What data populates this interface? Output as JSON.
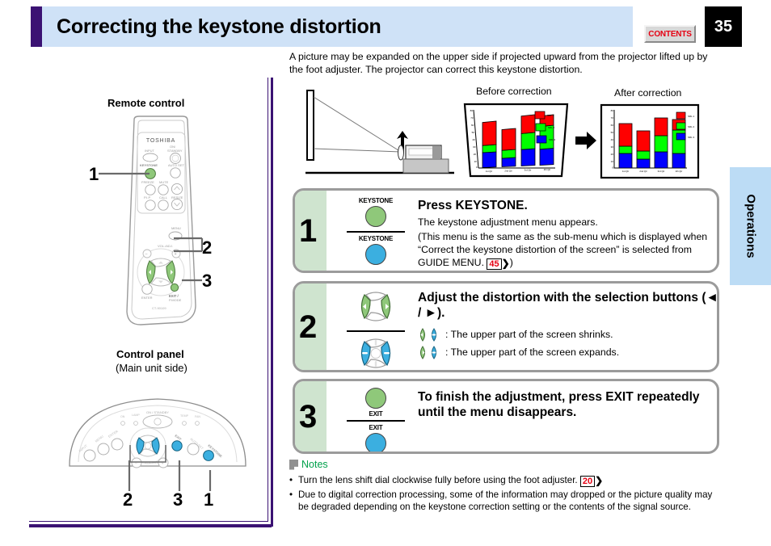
{
  "header": {
    "title": "Correcting the keystone distortion",
    "contents_label": "CONTENTS",
    "page_number": "35"
  },
  "side_tab": {
    "label": "Operations"
  },
  "intro": "A picture may be expanded on the upper side if projected upward from the projector lifted up by the foot adjuster. The projector can correct this keystone distortion.",
  "figures": {
    "before_caption": "Before correction",
    "after_caption": "After correction"
  },
  "left_column": {
    "remote_label": "Remote control",
    "control_panel_label": "Control panel",
    "control_panel_sub": "(Main unit side)",
    "remote_brand": "TOSHIBA",
    "remote_model": "CT-90109",
    "remote_callouts": [
      "1",
      "2",
      "3"
    ],
    "panel_callouts": [
      "2",
      "3",
      "1"
    ],
    "remote_button_labels": [
      "INPUT",
      "ON/ STANDBY",
      "KEYSTONE",
      "AUTO SET",
      "FREEZE",
      "MUTE",
      "P.IP",
      "CALL",
      "RESIZE",
      "MENU",
      "VOL./ADJ.",
      "ENTER",
      "EXIT/ P.MODE"
    ],
    "panel_labels": [
      "ON / STANDBY",
      "ON",
      "LAMP",
      "TEMP",
      "FAN",
      "INPUT",
      "MENU",
      "ENTER",
      "EXIT",
      "AUTO SET",
      "KEYSTONE",
      "VOL./ADJ."
    ]
  },
  "steps": [
    {
      "number": "1",
      "button_top_caption": "KEYSTONE",
      "button_bottom_caption": "KEYSTONE",
      "title": "Press KEYSTONE.",
      "lines": [
        "The keystone adjustment menu appears.",
        "(This menu is the same as the sub-menu which is displayed when “Correct the keystone distortion of the screen” is selected from GUIDE MENU."
      ],
      "page_ref": "45",
      "line_tail": ")"
    },
    {
      "number": "2",
      "title": "Adjust the distortion with the selection buttons (◄ / ►).",
      "bullets": [
        ": The upper part of the screen shrinks.",
        ": The upper part of the screen expands."
      ]
    },
    {
      "number": "3",
      "button_top_caption": "EXIT",
      "button_bottom_caption": "EXIT",
      "title": "To finish the adjustment, press EXIT repeatedly until the menu disappears."
    }
  ],
  "notes": {
    "heading": "Notes",
    "items": [
      {
        "text": "Turn the lens shift dial clockwise fully before using the foot adjuster.",
        "page_ref": "20"
      },
      {
        "text": "Due to digital correction processing, some of the information may dropped or the picture quality may be degraded depending on the keystone correction setting or the contents of the signal source.",
        "page_ref": ""
      }
    ],
    "bullet": "•"
  },
  "colors": {
    "accent_purple": "#3b1273",
    "header_blue": "#cfe2f7",
    "tab_blue": "#bcdcf5",
    "step_green": "#cfe4cf",
    "button_green": "#8fc87a",
    "button_blue": "#3bafe0",
    "red": "#e60012",
    "notes_green": "#00a14b"
  },
  "chart_data": [
    {
      "id": "before-correction",
      "type": "bar",
      "stacked": true,
      "title": "Before correction",
      "distorted": true,
      "categories": [
        "1st Qtr",
        "2nd Qtr",
        "3rd Qtr",
        "4th Qtr"
      ],
      "series": [
        {
          "name": "SRL 3",
          "color": "#0000ff",
          "values": [
            20,
            12,
            22,
            20
          ]
        },
        {
          "name": "SRL 2",
          "color": "#00ff00",
          "values": [
            10,
            11,
            22,
            32
          ]
        },
        {
          "name": "SRL 1",
          "color": "#ff0000",
          "values": [
            35,
            31,
            35,
            22
          ]
        }
      ],
      "yticks": [
        "0",
        "10",
        "20",
        "30",
        "40",
        "50",
        "60",
        "70",
        "80"
      ],
      "ylim": [
        0,
        80
      ],
      "legend": "right",
      "grid": false
    },
    {
      "id": "after-correction",
      "type": "bar",
      "stacked": true,
      "title": "After correction",
      "distorted": false,
      "categories": [
        "1st Qtr",
        "2nd Qtr",
        "3rd Qtr",
        "4th Qtr"
      ],
      "series": [
        {
          "name": "SRL 3",
          "color": "#0000ff",
          "values": [
            20,
            12,
            22,
            20
          ]
        },
        {
          "name": "SRL 2",
          "color": "#00ff00",
          "values": [
            10,
            11,
            22,
            32
          ]
        },
        {
          "name": "SRL 1",
          "color": "#ff0000",
          "values": [
            35,
            31,
            35,
            22
          ]
        }
      ],
      "yticks": [
        "0",
        "10",
        "20",
        "30",
        "40",
        "50",
        "60",
        "70",
        "80"
      ],
      "ylim": [
        0,
        80
      ],
      "legend": "right",
      "grid": false
    }
  ]
}
